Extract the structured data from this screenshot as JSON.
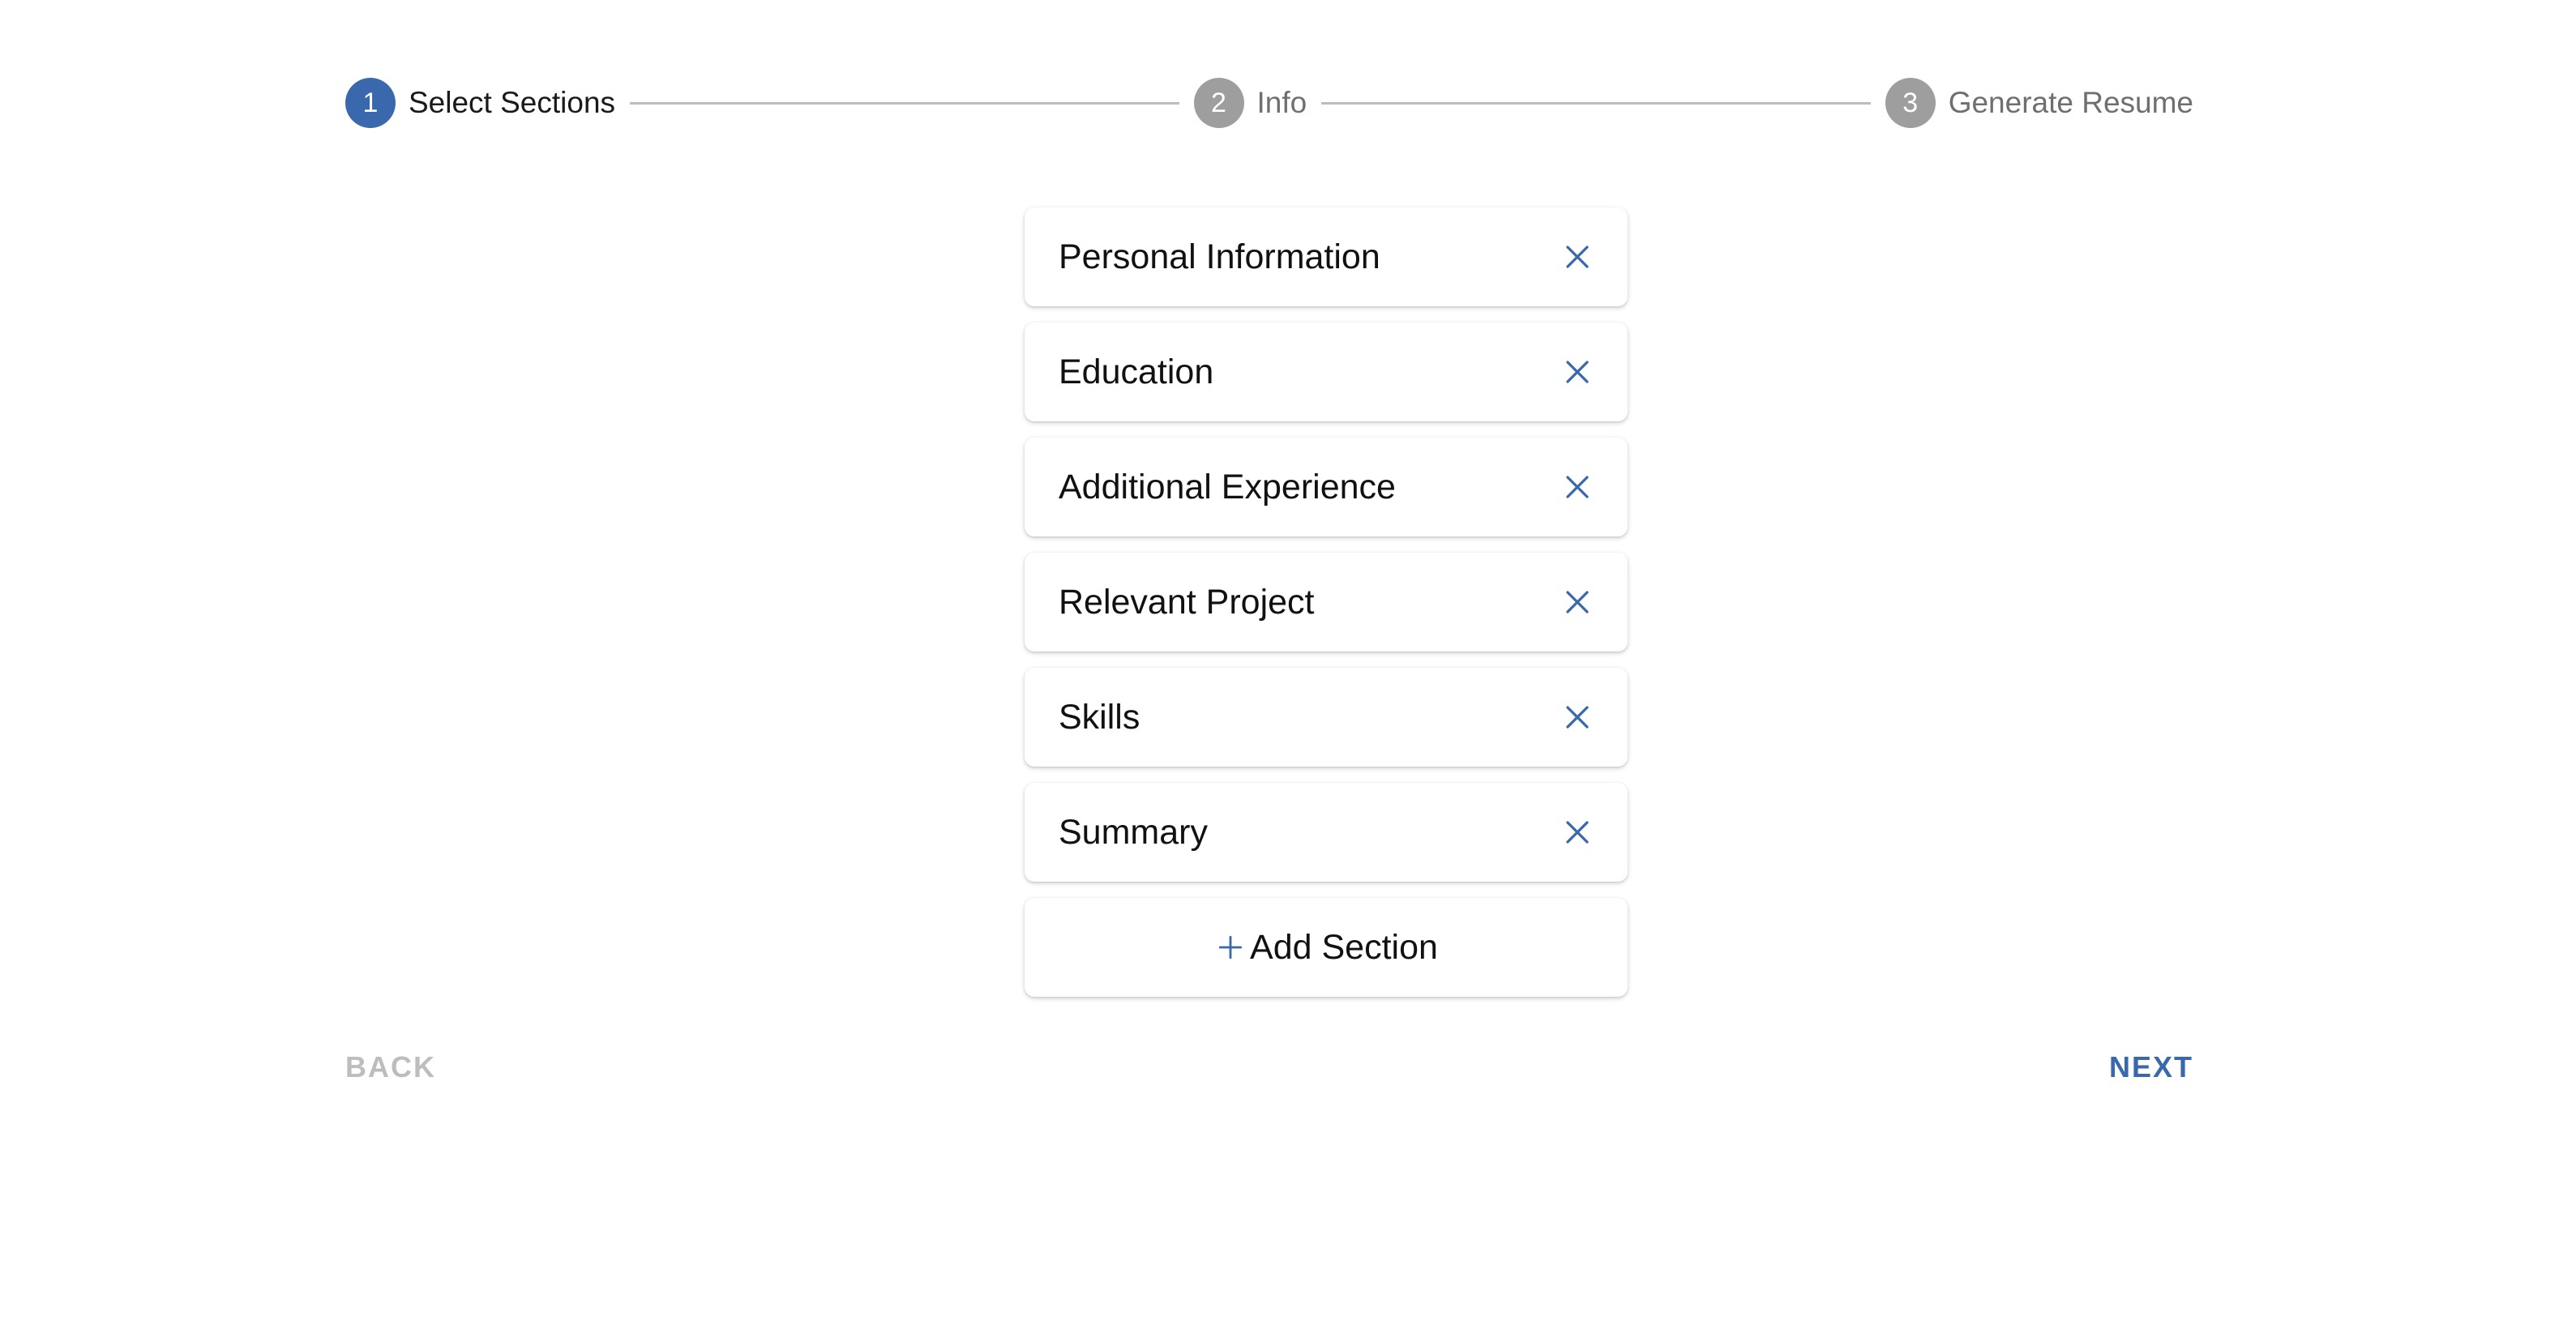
{
  "colors": {
    "accent": "#3a68ad",
    "inactive_step": "#9e9e9e",
    "disabled_text": "#bdbdbd"
  },
  "stepper": {
    "steps": [
      {
        "number": "1",
        "label": "Select Sections",
        "state": "active"
      },
      {
        "number": "2",
        "label": "Info",
        "state": "inactive"
      },
      {
        "number": "3",
        "label": "Generate Resume",
        "state": "inactive"
      }
    ]
  },
  "sections": {
    "items": [
      {
        "label": "Personal Information",
        "icon": "close-icon"
      },
      {
        "label": "Education",
        "icon": "close-icon"
      },
      {
        "label": "Additional Experience",
        "icon": "close-icon"
      },
      {
        "label": "Relevant Project",
        "icon": "close-icon"
      },
      {
        "label": "Skills",
        "icon": "close-icon"
      },
      {
        "label": "Summary",
        "icon": "close-icon"
      }
    ],
    "add_label": "Add Section",
    "add_icon": "plus-icon"
  },
  "nav": {
    "back_label": "BACK",
    "next_label": "NEXT",
    "back_disabled": true
  }
}
